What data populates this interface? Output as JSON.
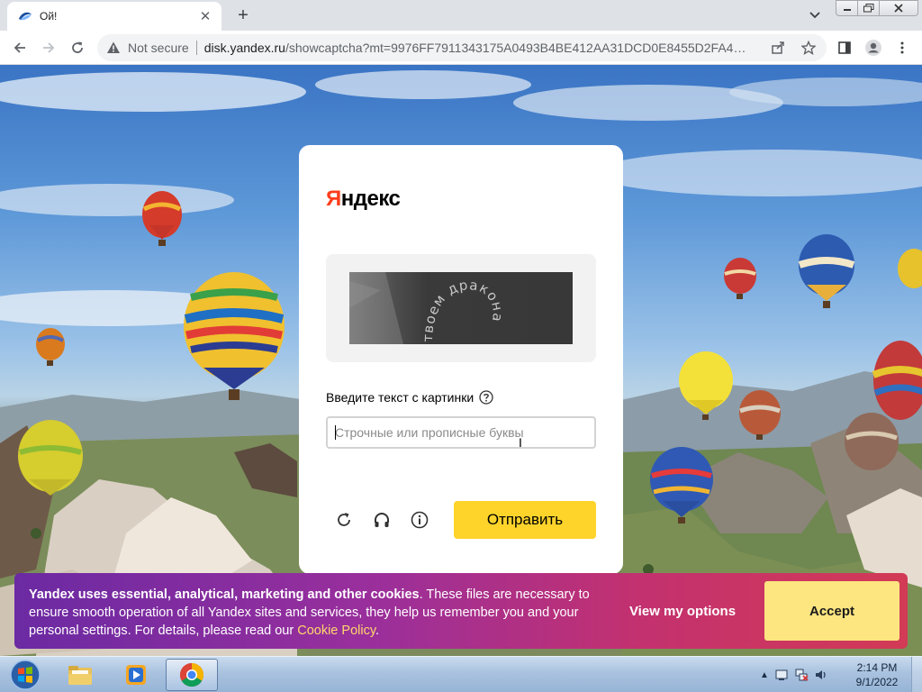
{
  "browser": {
    "tab_title": "Ой!",
    "tab_close_icon": "close-icon",
    "new_tab_label": "+",
    "omnibox": {
      "security_label": "Not secure",
      "url_host": "disk.yandex.ru",
      "url_rest": "/showcaptcha?mt=9976FF7911343175A0493B4BE412AA31DCD0E8455D2FA4C0D69..."
    }
  },
  "captcha_card": {
    "logo_first": "Я",
    "logo_rest": "ндекс",
    "captcha_text": "твоем дракона",
    "prompt": "Введите текст с картинки",
    "input_placeholder": "Строчные или прописные буквы",
    "input_value": "",
    "submit_label": "Отправить",
    "icons": [
      "refresh-icon",
      "audio-captcha-icon",
      "info-icon"
    ]
  },
  "cookie_banner": {
    "bold_text": "Yandex uses essential, analytical, marketing and other cookies",
    "body_text": ". These files are necessary to ensure smooth operation of all Yandex sites and services, they help us remember you and your personal settings. For details, please read our ",
    "link_text": "Cookie Policy",
    "end_text": ".",
    "view_options_label": "View my options",
    "accept_label": "Accept"
  },
  "taskbar": {
    "clock_time": "2:14 PM",
    "clock_date": "9/1/2022",
    "items": [
      "windows-explorer",
      "media-player",
      "google-chrome"
    ]
  },
  "colors": {
    "yandex_red": "#fc3f1d",
    "submit_yellow": "#fed42b",
    "accept_yellow": "#fde580",
    "cookie_gradient_start": "#6b2aa3",
    "cookie_gradient_end": "#d23a55"
  }
}
